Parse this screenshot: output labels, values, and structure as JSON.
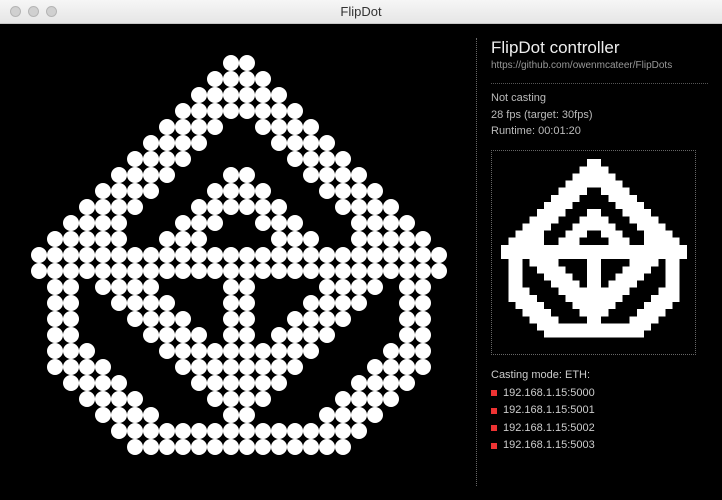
{
  "window": {
    "title": "FlipDot"
  },
  "header": {
    "title": "FlipDot controller",
    "url": "https://github.com/owenmcateer/FlipDots"
  },
  "status": {
    "casting": "Not casting",
    "fps": "28 fps (target: 30fps)",
    "runtime": "Runtime: 00:01:20"
  },
  "casting": {
    "mode_label": "Casting mode: ETH:",
    "targets": [
      "192.168.1.15:5000",
      "192.168.1.15:5001",
      "192.168.1.15:5002",
      "192.168.1.15:5003"
    ]
  },
  "display": {
    "cols": 28,
    "rows": 28,
    "pattern": [
      "0000000000000000000000000000",
      "0000000000000110000000000000",
      "0000000000001111000000000000",
      "0000000000011111100000000000",
      "0000000000111111110000000000",
      "0000000001111001111000000000",
      "0000000011110000111100000000",
      "0000000111100000011110000000",
      "0000001111000110001111000000",
      "0000011110001111000111100000",
      "0000111100011111100011110000",
      "0001111000111001110001111000",
      "0011111001110000111001111100",
      "0111111111111111111111111110",
      "0111111111111111111111111110",
      "0011011110000110000111101100",
      "0011001111000110001111001100",
      "0011000111100110011110001100",
      "0011000011110110111100001100",
      "0011100001111111111000011100",
      "0011110000111111110000111100",
      "0001111000011111100001111000",
      "0000111100001111000011110000",
      "0000011110000110000111100000",
      "0000001111111111111111000000",
      "0000000111111111111110000000",
      "0000000000000000000000000000",
      "0000000000000000000000000000"
    ]
  }
}
